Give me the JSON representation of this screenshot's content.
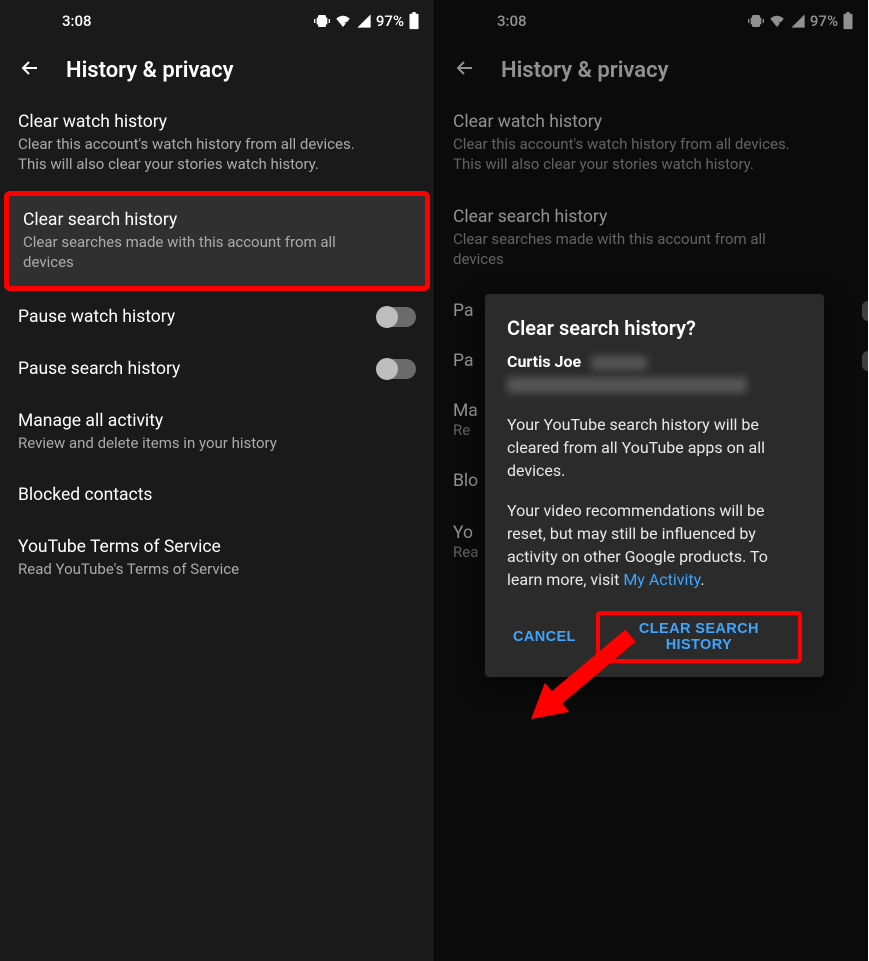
{
  "status": {
    "time": "3:08",
    "battery_pct": "97%"
  },
  "header": {
    "title": "History & privacy"
  },
  "items": {
    "clear_watch": {
      "title": "Clear watch history",
      "sub": "Clear this account's watch history from all devices. This will also clear your stories watch history."
    },
    "clear_search": {
      "title": "Clear search history",
      "sub": "Clear searches made with this account from all devices"
    },
    "pause_watch": {
      "title": "Pause watch history"
    },
    "pause_search": {
      "title": "Pause search history"
    },
    "manage_activity": {
      "title": "Manage all activity",
      "sub": "Review and delete items in your history"
    },
    "blocked_contacts": {
      "title": "Blocked contacts"
    },
    "terms": {
      "title": "YouTube Terms of Service",
      "sub": "Read YouTube's Terms of Service"
    }
  },
  "right_panel": {
    "pause_watch_partial": "Pa",
    "pause_search_partial": "Pa",
    "manage_partial_t": "Ma",
    "manage_partial_s": "Re",
    "blocked_partial": "Blo",
    "terms_partial_t": "Yo",
    "terms_partial_s": "Rea"
  },
  "dialog": {
    "title": "Clear search history?",
    "user_name": "Curtis Joe",
    "body1": "Your YouTube search history will be cleared from all YouTube apps on all devices.",
    "body2_pre": "Your video recommendations will be reset, but may still be influenced by activity on other Google products. To learn more, visit ",
    "body2_link": "My Activity",
    "body2_post": ".",
    "cancel": "CANCEL",
    "confirm": "CLEAR SEARCH HISTORY"
  }
}
